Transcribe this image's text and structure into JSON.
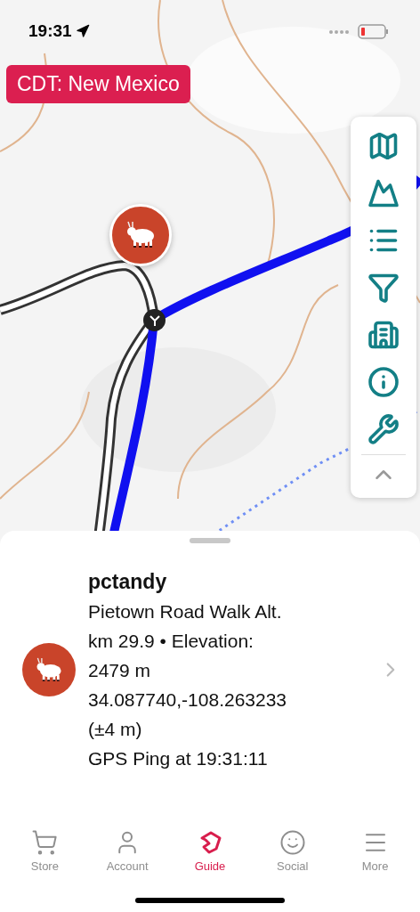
{
  "status_bar": {
    "time": "19:31"
  },
  "route_badge": "CDT: New Mexico",
  "map_tools": [
    {
      "kind": "map"
    },
    {
      "kind": "terrain"
    },
    {
      "kind": "list"
    },
    {
      "kind": "filter"
    },
    {
      "kind": "buildings"
    },
    {
      "kind": "info"
    },
    {
      "kind": "tools"
    },
    {
      "kind": "collapse"
    }
  ],
  "location_card": {
    "name": "pctandy",
    "lines": [
      "Pietown Road Walk Alt.",
      "km 29.9 • Elevation:",
      "2479 m",
      "34.087740,-108.263233",
      "(±4 m)",
      "GPS Ping at 19:31:11"
    ]
  },
  "tab_bar": [
    {
      "label": "Store",
      "kind": "store",
      "selected": false
    },
    {
      "label": "Account",
      "kind": "account",
      "selected": false
    },
    {
      "label": "Guide",
      "kind": "guide",
      "selected": true
    },
    {
      "label": "Social",
      "kind": "social",
      "selected": false
    },
    {
      "label": "More",
      "kind": "more",
      "selected": false
    }
  ]
}
